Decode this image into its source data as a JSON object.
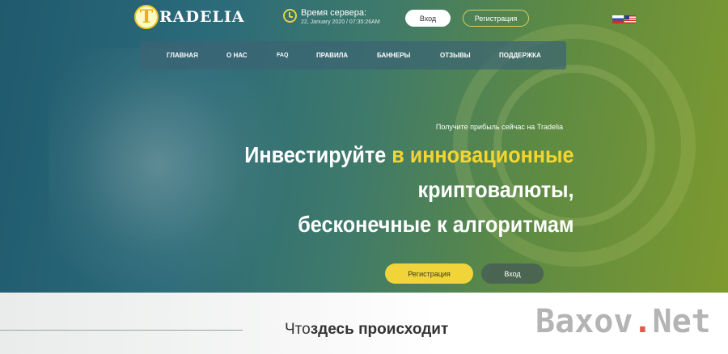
{
  "brand": {
    "logo_letter": "T",
    "logo_text": "RADELIA"
  },
  "server": {
    "label": "Время сервера:",
    "value": "22, January 2020 / 07:35:26AM"
  },
  "header": {
    "login_label": "Вход",
    "register_label": "Регистрация"
  },
  "languages": [
    "ru",
    "en"
  ],
  "nav": [
    {
      "label": "ГЛАВНАЯ"
    },
    {
      "label": "О НАС"
    },
    {
      "label": "FAQ"
    },
    {
      "label": "ПРАВИЛА"
    },
    {
      "label": "БАННЕРЫ"
    },
    {
      "label": "ОТЗЫВЫ"
    },
    {
      "label": "ПОДДЕРЖКА"
    }
  ],
  "hero": {
    "subtitle": "Получите прибыль сейчас на Tradelia",
    "headline_part1": "Инвестируйте",
    "headline_highlight": "в инновационные",
    "headline_line2": "криптовалюты,",
    "headline_line3": "бесконечные к алгоритмам",
    "register_button": "Регистрация",
    "login_button": "Вход"
  },
  "section": {
    "title_light": "Что",
    "title_bold": "здесь происходит"
  },
  "watermark": {
    "part1": "Baxov",
    "dot": ".",
    "part2": "Net"
  },
  "colors": {
    "accent_yellow": "#f0d43a",
    "hero_start": "#1f5a6e",
    "hero_end": "#7e9a2e"
  }
}
